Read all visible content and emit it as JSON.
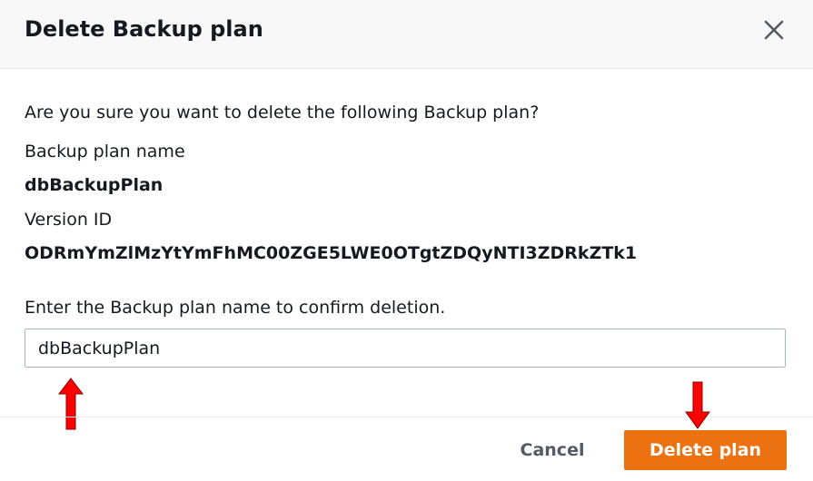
{
  "dialog": {
    "title": "Delete Backup plan",
    "question": "Are you sure you want to delete the following Backup plan?",
    "plan_name_label": "Backup plan name",
    "plan_name_value": "dbBackupPlan",
    "version_id_label": "Version ID",
    "version_id_value": "ODRmYmZlMzYtYmFhMC00ZGE5LWE0OTgtZDQyNTI3ZDRkZTk1",
    "confirm_label": "Enter the Backup plan name to confirm deletion.",
    "confirm_input_value": "dbBackupPlan",
    "cancel_label": "Cancel",
    "delete_label": "Delete plan"
  },
  "icons": {
    "close": "close-icon",
    "annotation_up": "red-arrow-up-icon",
    "annotation_down": "red-arrow-down-icon"
  },
  "colors": {
    "primary_button": "#ec7211",
    "annotation_arrow": "#ff0000",
    "header_background": "#f8f8f8"
  }
}
